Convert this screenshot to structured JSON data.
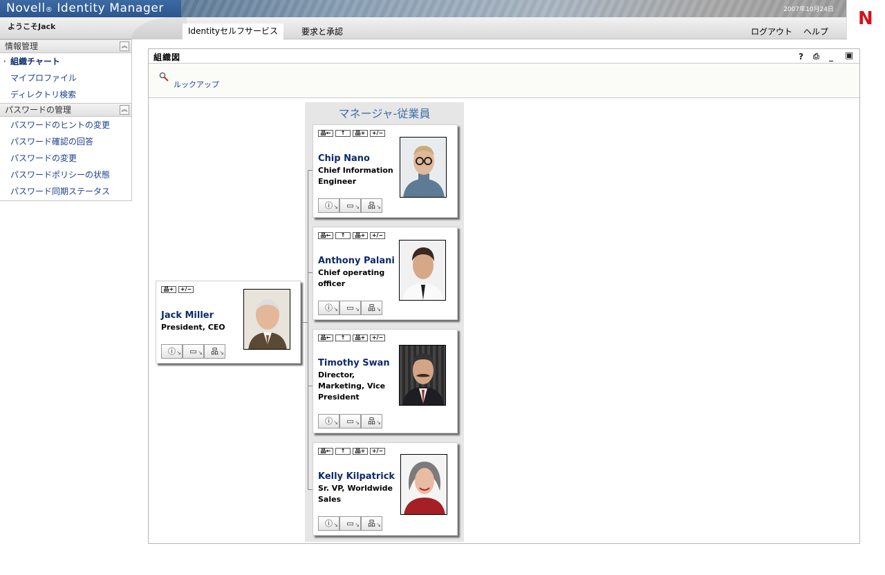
{
  "header": {
    "brand": "Novell",
    "brand_suffix": "Identity Manager",
    "date": "2007年10月24日",
    "logo_letter": "N",
    "welcome": "ようこそJack"
  },
  "nav": {
    "tabs": [
      {
        "label": "Identityセルフサービス",
        "active": true
      },
      {
        "label": "要求と承認",
        "active": false
      }
    ],
    "logout": "ログアウト",
    "help": "ヘルプ"
  },
  "sidebar": {
    "sections": [
      {
        "title": "情報管理",
        "items": [
          {
            "label": "組織チャート",
            "active": true
          },
          {
            "label": "マイプロファイル",
            "active": false
          },
          {
            "label": "ディレクトリ検索",
            "active": false
          }
        ]
      },
      {
        "title": "パスワードの管理",
        "items": [
          {
            "label": "パスワードのヒントの変更",
            "active": false
          },
          {
            "label": "パスワード確認の回答",
            "active": false
          },
          {
            "label": "パスワードの変更",
            "active": false
          },
          {
            "label": "パスワードポリシーの状態",
            "active": false
          },
          {
            "label": "パスワード同期ステータス",
            "active": false
          }
        ]
      }
    ]
  },
  "portlet": {
    "title": "組織図",
    "lookup_label": "ルックアップ",
    "column_title": "マネージャ-従業員"
  },
  "root_person": {
    "name": "Jack Miller",
    "title": "President, CEO",
    "mini_buttons": [
      "品品+",
      "+/−"
    ]
  },
  "reports": [
    {
      "name": "Chip Nano",
      "title_lines": [
        "Chief Information",
        "Engineer"
      ]
    },
    {
      "name": "Anthony Palani",
      "title_lines": [
        "Chief operating",
        "officer"
      ]
    },
    {
      "name": "Timothy Swan",
      "title_lines": [
        "Director,",
        "Marketing, Vice",
        "President"
      ]
    },
    {
      "name": "Kelly Kilpatrick",
      "title_lines": [
        "Sr. VP, Worldwide",
        "Sales"
      ]
    }
  ],
  "colors": {
    "brand_blue": "#2c568c",
    "link_blue": "#1a3f8f",
    "name_blue": "#0e2a6b",
    "column_title_blue": "#3e6fa8",
    "logo_red": "#d6121c"
  }
}
